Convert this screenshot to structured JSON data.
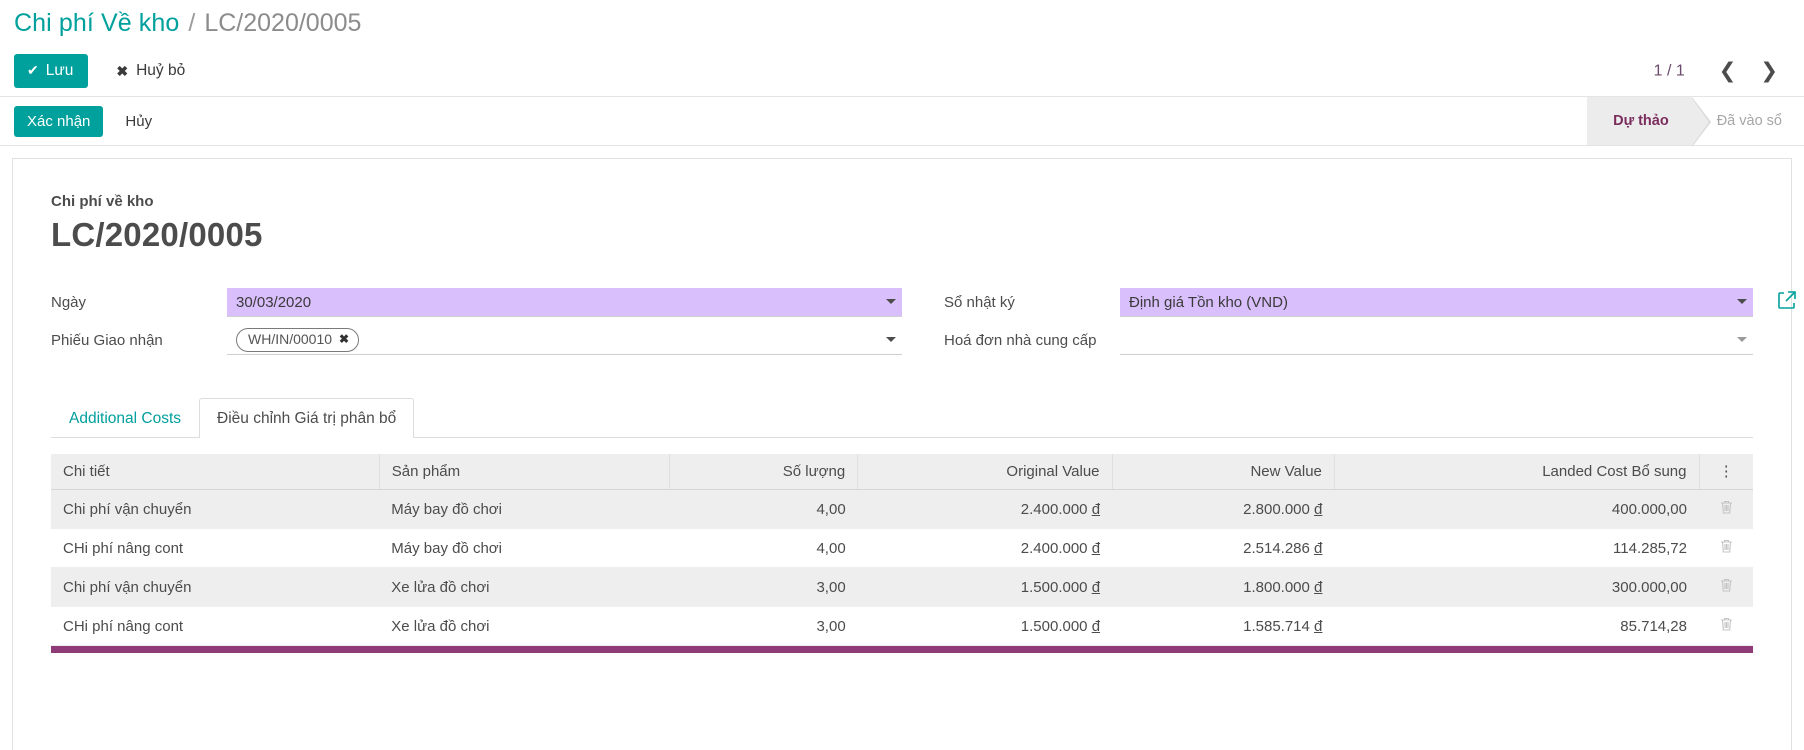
{
  "breadcrumb": {
    "root": "Chi phí Về kho",
    "separator": "/",
    "current": "LC/2020/0005"
  },
  "actions": {
    "save_label": "Lưu",
    "save_icon": "check-icon",
    "discard_label": "Huỷ bỏ",
    "discard_icon": "x-icon",
    "pager_count": "1 / 1",
    "prev_icon": "❮",
    "next_icon": "❯"
  },
  "statusbar": {
    "validate_label": "Xác nhận",
    "cancel_label": "Hủy",
    "steps": [
      {
        "label": "Dự thảo",
        "active": true
      },
      {
        "label": "Đã vào sổ",
        "active": false
      }
    ]
  },
  "document": {
    "subtitle": "Chi phí về kho",
    "title": "LC/2020/0005"
  },
  "form": {
    "left": [
      {
        "label": "Ngày",
        "value": "30/03/2020",
        "placeholder": "",
        "highlight": true,
        "type": "date"
      },
      {
        "label": "Phiếu Giao nhận",
        "tag": "WH/IN/00010",
        "tag_remove_icon": "✖",
        "type": "tags"
      }
    ],
    "right": [
      {
        "label": "Sổ nhật ký",
        "value": "Định giá Tồn kho (VND)",
        "placeholder": "",
        "highlight": true,
        "type": "select",
        "external_link_icon": "↗"
      },
      {
        "label": "Hoá đơn nhà cung cấp",
        "value": "",
        "placeholder": "",
        "highlight": false,
        "type": "select"
      }
    ]
  },
  "tabs": [
    {
      "label": "Additional Costs",
      "active": false
    },
    {
      "label": "Điều chỉnh Giá trị phân bổ",
      "active": true
    }
  ],
  "table": {
    "columns": [
      {
        "label": "Chi tiết",
        "align": "left"
      },
      {
        "label": "Sản phẩm",
        "align": "left"
      },
      {
        "label": "Số lượng",
        "align": "right"
      },
      {
        "label": "Original Value",
        "align": "right"
      },
      {
        "label": "New Value",
        "align": "right"
      },
      {
        "label": "Landed Cost Bổ sung",
        "align": "right"
      }
    ],
    "options_icon": "⋮",
    "row_delete_icon": "🗑",
    "currency_symbol": "đ",
    "rows": [
      {
        "detail": "Chi phí vận chuyển",
        "product": "Máy bay đồ chơi",
        "quantity": "4,00",
        "original_value": "2.400.000",
        "new_value": "2.800.000",
        "landed_cost": "400.000,00"
      },
      {
        "detail": "CHi phí nâng cont",
        "product": "Máy bay đồ chơi",
        "quantity": "4,00",
        "original_value": "2.400.000",
        "new_value": "2.514.286",
        "landed_cost": "114.285,72"
      },
      {
        "detail": "Chi phí vận chuyển",
        "product": "Xe lửa đồ chơi",
        "quantity": "3,00",
        "original_value": "1.500.000",
        "new_value": "1.800.000",
        "landed_cost": "300.000,00"
      },
      {
        "detail": "CHi phí nâng cont",
        "product": "Xe lửa đồ chơi",
        "quantity": "3,00",
        "original_value": "1.500.000",
        "new_value": "1.585.714",
        "landed_cost": "85.714,28"
      }
    ]
  },
  "colors": {
    "accent": "#00a09d",
    "highlight_field": "#d9bffc",
    "footer_bar": "#8e3b77",
    "status_active_text": "#7b2d5e"
  }
}
